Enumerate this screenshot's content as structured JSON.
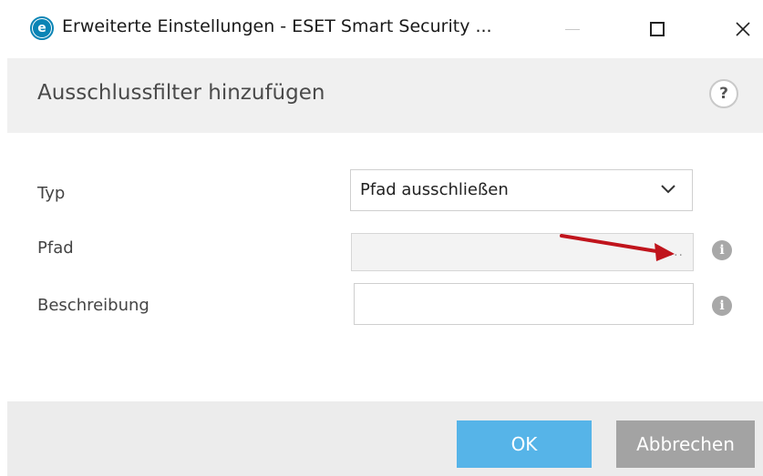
{
  "window": {
    "title": "Erweiterte Einstellungen - ESET Smart Security ...",
    "logo_letter": "e",
    "maximize_glyph": "",
    "close_glyph": "✕"
  },
  "header": {
    "title": "Ausschlussfilter hinzufügen",
    "help_label": "?"
  },
  "form": {
    "type_label": "Typ",
    "type_value": "Pfad ausschließen",
    "path_label": "Pfad",
    "path_value": "",
    "path_browse": "...",
    "description_label": "Beschreibung",
    "description_value": "",
    "info_glyph": "i"
  },
  "footer": {
    "ok_label": "OK",
    "cancel_label": "Abbrechen"
  },
  "colors": {
    "ok_button": "#56b4e8",
    "cancel_button": "#a3a3a3",
    "brand": "#0a84b5",
    "annotation_arrow": "#c0141c"
  },
  "icons": {
    "app": "eset-logo-icon",
    "help": "help-icon",
    "dropdown": "chevron-down-icon",
    "info": "info-icon",
    "annotation": "red-arrow-icon"
  }
}
